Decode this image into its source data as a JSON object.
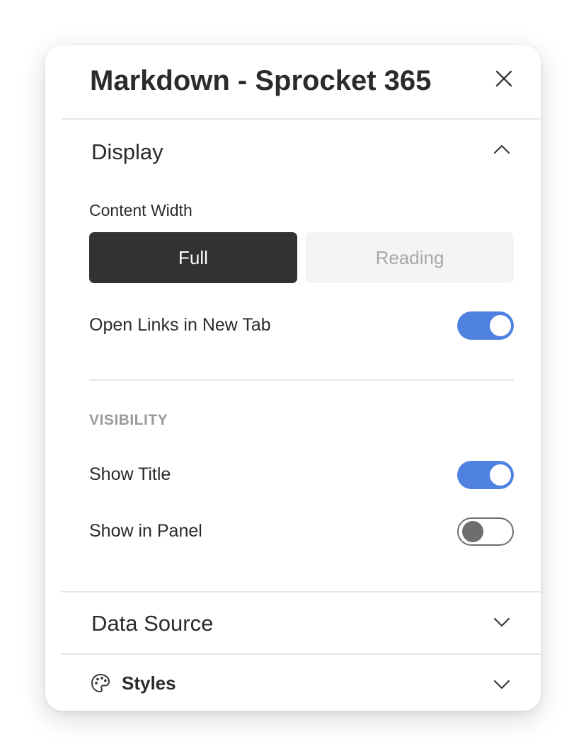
{
  "panel": {
    "title": "Markdown - Sprocket 365",
    "close_icon": "close-icon"
  },
  "display": {
    "label": "Display",
    "expanded": true,
    "content_width": {
      "label": "Content Width",
      "options": [
        "Full",
        "Reading"
      ],
      "selected": "Full"
    },
    "open_links": {
      "label": "Open Links in New Tab",
      "on": true
    },
    "visibility": {
      "caption": "VISIBILITY",
      "show_title": {
        "label": "Show Title",
        "on": true
      },
      "show_in_panel": {
        "label": "Show in Panel",
        "on": false
      }
    }
  },
  "data_source": {
    "label": "Data Source",
    "expanded": false
  },
  "styles": {
    "label": "Styles",
    "icon": "palette-icon",
    "expanded": false
  },
  "colors": {
    "toggle_on": "#4f82e0",
    "segment_selected": "#323232",
    "segment_unselected": "#f4f4f4"
  }
}
